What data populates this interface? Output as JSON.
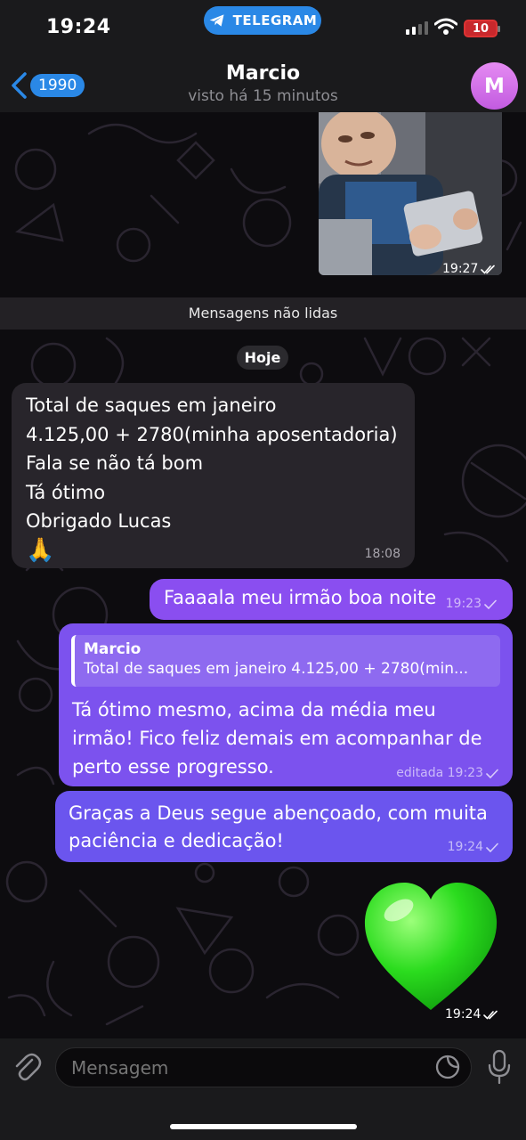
{
  "status_bar": {
    "time": "19:24",
    "app_pill": "TELEGRAM",
    "battery": "10"
  },
  "header": {
    "back_count": "1990",
    "name": "Marcio",
    "status": "visto há 15 minutos",
    "avatar_initial": "M",
    "avatar_color": "#d077ea"
  },
  "messages": {
    "photo_time": "19:27",
    "unread_divider": "Mensagens não lidas",
    "date_chip": "Hoje",
    "incoming": {
      "lines": [
        "Total de saques em janeiro",
        "4.125,00 + 2780(minha aposentadoria)",
        "Fala se não tá bom",
        "Tá ótimo",
        "Obrigado Lucas"
      ],
      "emoji": "🙏",
      "time": "18:08"
    },
    "out1": {
      "text": "Faaaala meu irmão boa noite",
      "time": "19:23"
    },
    "out2": {
      "reply_name": "Marcio",
      "reply_text": "Total de saques em janeiro 4.125,00 + 2780(min...",
      "lines": [
        "Tá ótimo mesmo, acima da média meu",
        "irmão! Fico feliz demais em acompanhar de",
        "perto esse progresso."
      ],
      "time": "editada 19:23"
    },
    "out3": {
      "lines": [
        "Graças a Deus segue abençoado, com muita",
        "paciência e dedicação!"
      ],
      "time": "19:24"
    },
    "heart_time": "19:24"
  },
  "composer": {
    "placeholder": "Mensagem"
  },
  "colors": {
    "accent": "#2a88e6",
    "outgoing": "#7c52ee",
    "incoming": "#28252b"
  }
}
